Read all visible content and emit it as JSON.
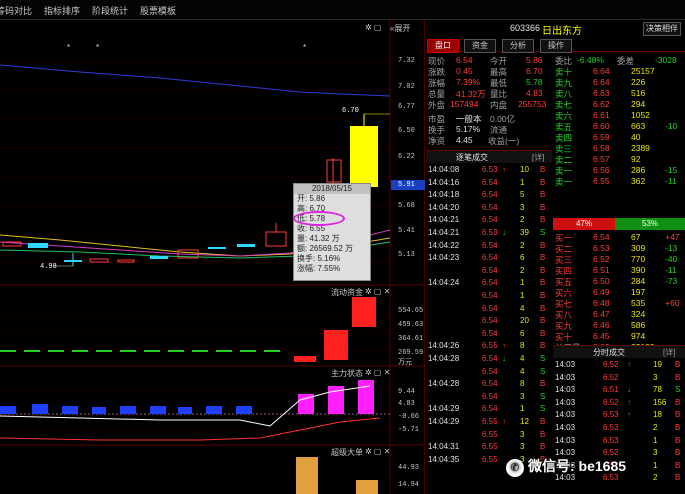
{
  "topnav": [
    "筹码对比",
    "指标排序",
    "阶段统计",
    "股票模板"
  ],
  "expand_label": "展开",
  "stock": {
    "code": "603366",
    "name": "日出东方",
    "decision_btn": "决策相伴"
  },
  "tabs": [
    "盘口",
    "资金",
    "分析",
    "操作"
  ],
  "price_axis": [
    "7.32",
    "7.02",
    "6.77",
    "6.50",
    "6.22",
    "5.91",
    "5.68",
    "5.41",
    "5.13"
  ],
  "price_current": "5.91",
  "high_label": "6.70",
  "low_label": "4.98",
  "tooltip": {
    "date": "2018/05/15",
    "open": "开: 5.86",
    "high": "高: 6.70",
    "close_circled": "低: 5.78",
    "close": "收: 6.55",
    "vol": "量: 41.32 万",
    "amount": "额: 26569.52 万",
    "turnover": "换手: 5.16%",
    "change": "涨幅: 7.55%"
  },
  "panel2": {
    "title": "流动资金",
    "axis": [
      "554.65",
      "459.63",
      "364.61",
      "269.59",
      "203.79"
    ],
    "unit": "万元"
  },
  "panel3": {
    "title": "主力状态",
    "axis": [
      "9.44",
      "4.83",
      "-0.66",
      "-5.71"
    ]
  },
  "panel4": {
    "title": "超级大单",
    "axis": [
      "44.93",
      "14.94"
    ]
  },
  "quote_left": [
    [
      "现价",
      "6.54",
      "今开",
      "5.86"
    ],
    [
      "涨跌",
      "0.45",
      "最高",
      "6.70"
    ],
    [
      "涨幅",
      "7.39%",
      "最低",
      "5.78"
    ],
    [
      "总量",
      "41.32万",
      "量比",
      "4.83"
    ],
    [
      "外盘",
      "157494",
      "内盘",
      "255753"
    ]
  ],
  "quote_left2": [
    [
      "市盈",
      "一般本",
      "0.00亿"
    ],
    [
      "换手",
      "5.17%",
      "流通",
      "8.00亿"
    ],
    [
      "净资",
      "4.45",
      "收益(一)",
      "-0.021"
    ]
  ],
  "orderbook_header": [
    "委比",
    "-6.48%",
    "委差",
    "-3028"
  ],
  "asks": [
    [
      "卖十",
      "6.64",
      "25157"
    ],
    [
      "卖九",
      "6.64",
      "226"
    ],
    [
      "卖八",
      "6.63",
      "516"
    ],
    [
      "卖七",
      "6.62",
      "294"
    ],
    [
      "卖六",
      "6.61",
      "1052"
    ],
    [
      "卖五",
      "6.60",
      "663",
      "-10"
    ],
    [
      "卖四",
      "6.59",
      "40"
    ],
    [
      "卖三",
      "6.58",
      "2389"
    ],
    [
      "卖二",
      "6.57",
      "92"
    ],
    [
      "卖一",
      "6.56",
      "286",
      "-15"
    ],
    [
      "卖一",
      "6.55",
      "362",
      "-11"
    ]
  ],
  "ask_total": [
    "总卖量",
    "6.67",
    "25157"
  ],
  "buy_sell_bar": {
    "left": "47%",
    "right": "53%"
  },
  "bids": [
    [
      "买一",
      "6.54",
      "67",
      "+47"
    ],
    [
      "买二",
      "6.53",
      "309",
      "-13"
    ],
    [
      "买三",
      "6.52",
      "770",
      "-40"
    ],
    [
      "买四",
      "6.51",
      "390",
      "-11"
    ],
    [
      "买五",
      "6.50",
      "284",
      "-73"
    ],
    [
      "买六",
      "6.49",
      "197",
      ""
    ],
    [
      "买七",
      "6.48",
      "535",
      "+60"
    ],
    [
      "买八",
      "6.47",
      "324",
      ""
    ],
    [
      "买九",
      "6.46",
      "586",
      ""
    ],
    [
      "买十",
      "6.45",
      "974",
      ""
    ]
  ],
  "bid_total": [
    "总买量",
    "6.03",
    "22129"
  ],
  "ticks_title": "逐笔成交",
  "ticks_btn": "[详]",
  "ticks": [
    [
      "14:04:08",
      "6.53",
      "↑",
      "10",
      "B"
    ],
    [
      "14:04:16",
      "6.54",
      "",
      "1",
      "B"
    ],
    [
      "14:04:18",
      "6.54",
      "",
      "5",
      "B"
    ],
    [
      "14:04:20",
      "6.54",
      "",
      "3",
      "B"
    ],
    [
      "14:04:21",
      "6.54",
      "",
      "2",
      "B"
    ],
    [
      "14:04:21",
      "6.53",
      "↓",
      "39",
      "S"
    ],
    [
      "14:04:22",
      "6.54",
      "",
      "2",
      "B"
    ],
    [
      "14:04:23",
      "6.54",
      "",
      "6",
      "B"
    ],
    [
      "",
      "6.54",
      "",
      "2",
      "B"
    ],
    [
      "14:04:24",
      "6.54",
      "",
      "1",
      "B"
    ],
    [
      "",
      "6.54",
      "",
      "1",
      "B"
    ],
    [
      "",
      "6.54",
      "",
      "4",
      "B"
    ],
    [
      "",
      "6.54",
      "",
      "20",
      "B"
    ],
    [
      "",
      "6.54",
      "",
      "6",
      "B"
    ],
    [
      "14:04:26",
      "6.55",
      "↑",
      "8",
      "B"
    ],
    [
      "14:04:28",
      "6.54",
      "↓",
      "4",
      "S"
    ],
    [
      "",
      "6.54",
      "",
      "4",
      "S"
    ],
    [
      "14:04:28",
      "6.54",
      "",
      "8",
      "B"
    ],
    [
      "",
      "6.54",
      "",
      "3",
      "S"
    ],
    [
      "14:04:29",
      "6.54",
      "",
      "1",
      "S"
    ],
    [
      "14:04:29",
      "6.55",
      "↑",
      "12",
      "B"
    ],
    [
      "",
      "6.55",
      "",
      "3",
      "B"
    ],
    [
      "14:04:31",
      "6.55",
      "",
      "3",
      "B"
    ],
    [
      "14:04:35",
      "6.55",
      "",
      "3",
      "B"
    ]
  ],
  "minute_title": "分时成交",
  "minute_btn": "[详]",
  "minute": [
    [
      "14:03",
      "6.52",
      "↑",
      "19",
      "B"
    ],
    [
      "14:03",
      "6.52",
      "",
      "3",
      "B"
    ],
    [
      "14:03",
      "6.51",
      "↓",
      "78",
      "S"
    ],
    [
      "14:03",
      "6.52",
      "↑",
      "156",
      "B"
    ],
    [
      "14:03",
      "6.53",
      "↑",
      "18",
      "B"
    ],
    [
      "14:03",
      "6.53",
      "",
      "2",
      "B"
    ],
    [
      "14:03",
      "6.53",
      "",
      "1",
      "B"
    ],
    [
      "14:03",
      "6.52",
      "",
      "3",
      "B"
    ],
    [
      "14:03",
      "6.52",
      "",
      "1",
      "B"
    ],
    [
      "14:03",
      "6.53",
      "",
      "2",
      "B"
    ]
  ],
  "watermark": "微信号: be1685"
}
